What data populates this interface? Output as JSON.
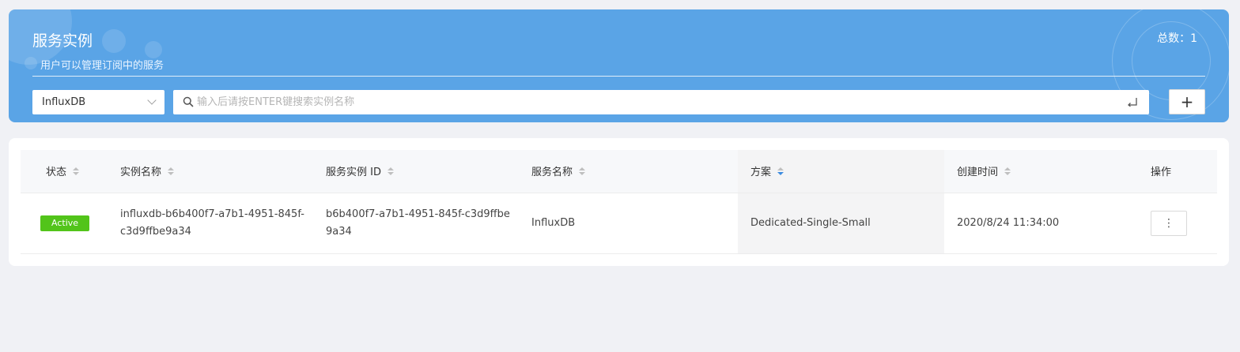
{
  "header": {
    "title": "服务实例",
    "subtitle": "用户可以管理订阅中的服务",
    "total": "总数：1"
  },
  "toolbar": {
    "type_select_value": "InfluxDB",
    "search_placeholder": "输入后请按ENTER键搜索实例名称",
    "add_label": "+"
  },
  "table": {
    "columns": {
      "status": "状态",
      "instance_name": "实例名称",
      "service_instance_id": "服务实例 ID",
      "service_name": "服务名称",
      "plan": "方案",
      "created_at": "创建时间",
      "actions": "操作"
    },
    "rows": [
      {
        "status": "Active",
        "instance_name": "influxdb-b6b400f7-a7b1-4951-845f-c3d9ffbe9a34",
        "service_instance_id": "b6b400f7-a7b1-4951-845f-c3d9ffbe9a34",
        "service_name": "InfluxDB",
        "plan": "Dedicated-Single-Small",
        "created_at": "2020/8/24 11:34:00",
        "more": "⋮"
      }
    ]
  },
  "colors": {
    "banner": "#5aa4e6",
    "active_badge": "#52c41a",
    "sort_active": "#3b8be0"
  }
}
